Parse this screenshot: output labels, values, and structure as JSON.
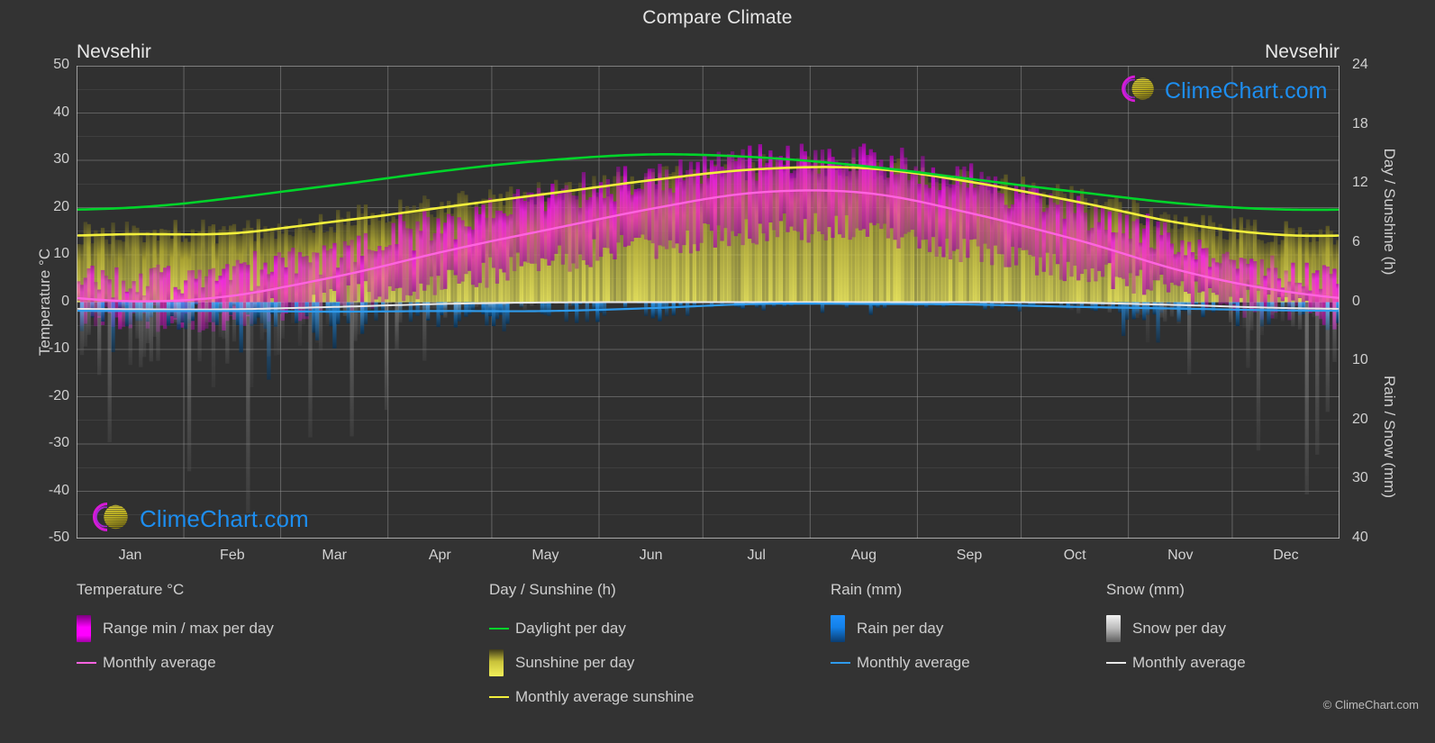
{
  "header": {
    "title": "Compare Climate",
    "location_left": "Nevsehir",
    "location_right": "Nevsehir"
  },
  "branding": {
    "logo_text": "ClimeChart.com",
    "copyright": "© ClimeChart.com",
    "logo_text_color": "#1d8ef0",
    "logo_crescent_color": "#d61ad6",
    "logo_sphere_color": "#d6c81e"
  },
  "legend": {
    "groups": [
      {
        "title": "Temperature °C",
        "items": [
          {
            "label": "Range min / max per day",
            "marker": "swatch",
            "color": "#ff00ff",
            "color2": "#8f0090"
          },
          {
            "label": "Monthly average",
            "marker": "line",
            "color": "#ff63e0"
          }
        ]
      },
      {
        "title": "Day / Sunshine (h)",
        "items": [
          {
            "label": "Daylight per day",
            "marker": "line",
            "color": "#00d42a"
          },
          {
            "label": "Sunshine per day",
            "marker": "swatch",
            "color": "#f3f05a",
            "color2": "#4a4520"
          },
          {
            "label": "Monthly average sunshine",
            "marker": "line",
            "color": "#f2ef3c"
          }
        ]
      },
      {
        "title": "Rain (mm)",
        "items": [
          {
            "label": "Rain per day",
            "marker": "swatch",
            "color": "#1e90ff",
            "color2": "#0b3d70"
          },
          {
            "label": "Monthly average",
            "marker": "line",
            "color": "#2f9bec"
          }
        ]
      },
      {
        "title": "Snow (mm)",
        "items": [
          {
            "label": "Snow per day",
            "marker": "swatch",
            "color": "#ffffff",
            "color2": "#6a6a6a"
          },
          {
            "label": "Monthly average",
            "marker": "line",
            "color": "#e8e8e8"
          }
        ]
      }
    ]
  },
  "chart_data": {
    "type": "area",
    "title": "Compare Climate",
    "subtitle": "Nevsehir",
    "grid": true,
    "legend_position": "bottom",
    "xlabel": "",
    "categories": [
      "Jan",
      "Feb",
      "Mar",
      "Apr",
      "May",
      "Jun",
      "Jul",
      "Aug",
      "Sep",
      "Oct",
      "Nov",
      "Dec"
    ],
    "axes": {
      "left": {
        "label": "Temperature °C",
        "unit": "°C",
        "ticks": [
          50,
          40,
          30,
          20,
          10,
          0,
          -10,
          -20,
          -30,
          -40,
          -50
        ],
        "range": [
          -50,
          50
        ]
      },
      "right_top": {
        "label": "Day / Sunshine (h)",
        "unit": "h",
        "ticks": [
          24,
          18,
          12,
          6,
          0
        ],
        "range": [
          0,
          24
        ],
        "maps_to_temperature": [
          0,
          50
        ]
      },
      "right_bottom": {
        "label": "Rain / Snow (mm)",
        "unit": "mm",
        "ticks": [
          0,
          10,
          20,
          30,
          40
        ],
        "range": [
          0,
          40
        ],
        "maps_to_temperature": [
          0,
          -50
        ]
      }
    },
    "series": [
      {
        "name": "Monthly average temperature",
        "color": "#ff63e0",
        "axis": "left",
        "unit": "°C",
        "values": [
          0.2,
          1.4,
          5.4,
          10.6,
          15.3,
          19.8,
          23.2,
          23.1,
          18.8,
          13.2,
          6.6,
          2.2
        ]
      },
      {
        "name": "Monthly average daily maximum temperature",
        "color": "#ff00ff",
        "axis": "left",
        "unit": "°C",
        "values": [
          4.5,
          6.0,
          11.0,
          16.5,
          21.5,
          26.5,
          30.0,
          30.2,
          25.5,
          19.5,
          12.0,
          6.5
        ]
      },
      {
        "name": "Monthly average daily minimum temperature",
        "color": "#8f0090",
        "axis": "left",
        "unit": "°C",
        "values": [
          -3.5,
          -2.8,
          0.2,
          4.5,
          8.5,
          12.0,
          15.2,
          15.3,
          11.2,
          7.0,
          1.8,
          -1.5
        ]
      },
      {
        "name": "Daylight per day",
        "color": "#00d42a",
        "axis": "right_top",
        "unit": "h",
        "values": [
          9.6,
          10.6,
          11.9,
          13.3,
          14.4,
          15.0,
          14.7,
          13.8,
          12.5,
          11.2,
          10.0,
          9.4
        ]
      },
      {
        "name": "Monthly average sunshine",
        "color": "#f2ef3c",
        "axis": "right_top",
        "unit": "h",
        "values": [
          6.9,
          7.0,
          8.2,
          9.6,
          11.0,
          12.4,
          13.5,
          13.6,
          12.2,
          10.2,
          8.0,
          6.8
        ]
      },
      {
        "name": "Rain monthly average",
        "color": "#2f9bec",
        "axis": "right_bottom",
        "unit": "mm",
        "values": [
          1.5,
          1.5,
          1.6,
          1.5,
          1.5,
          1.0,
          0.3,
          0.3,
          0.4,
          0.8,
          1.1,
          1.4
        ]
      },
      {
        "name": "Snow monthly average",
        "color": "#e8e8e8",
        "axis": "right_bottom",
        "unit": "mm",
        "values": [
          1.2,
          1.2,
          0.8,
          0.3,
          0.05,
          0.0,
          0.0,
          0.0,
          0.0,
          0.1,
          0.5,
          1.0
        ]
      }
    ]
  }
}
